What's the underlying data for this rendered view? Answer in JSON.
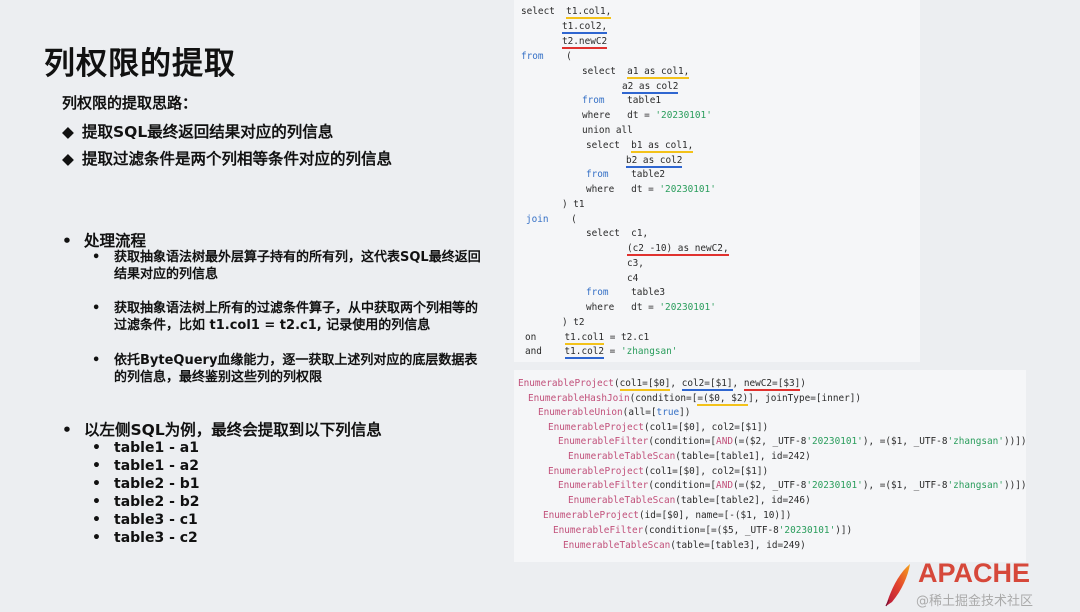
{
  "left": {
    "title": "列权限的提取",
    "subtitle": "列权限的提取思路：",
    "ideas": [
      "提取SQL最终返回结果对应的列信息",
      "提取过滤条件是两个列相等条件对应的列信息"
    ],
    "process_title": "处理流程",
    "steps": [
      "获取抽象语法树最外层算子持有的所有列，这代表SQL最终返回结果对应的列信息",
      "获取抽象语法树上所有的过滤条件算子，从中获取两个列相等的过滤条件，比如 t1.col1 = t2.c1, 记录使用的列信息",
      "依托ByteQuery血缘能力，逐一获取上述列对应的底层数据表的列信息，最终鉴别这些列的列权限"
    ],
    "example_title": "以左侧SQL为例，最终会提取到以下列信息",
    "relations": [
      "table1 - a1",
      "table1 - a2",
      "table2 - b1",
      "table2 - b2",
      "table3 - c1",
      "table3 - c2"
    ]
  },
  "sql": {
    "select": "select",
    "t1col1": "t1.col1,",
    "t1col2": "t1.col2,",
    "t2newc2": "t2.newC2",
    "from": "from",
    "lparen": "(",
    "a1": "a1 as col1,",
    "a2": "a2 as col2",
    "table1": "table1",
    "where": "where",
    "dteq": "dt = ",
    "date": "'20230101'",
    "unionall": "union all",
    "b1": "b1 as col1,",
    "b2": "b2 as col2",
    "table2": "table2",
    "t1close": ") t1",
    "join": "join",
    "c1": "c1,",
    "c2expr": "(c2 -10) as newC2,",
    "c3": "c3,",
    "c4": "c4",
    "table3": "table3",
    "t2close": ") t2",
    "on": "on",
    "oncol": "t1.col1",
    "oneq": " = t2.c1",
    "and": "and",
    "andcol": "t1.col2",
    "andeq": " = ",
    "zhangsan": "'zhangsan'"
  },
  "plan": [
    "EnumerableProject(col1=[$0], col2=[$1], newC2=[$3])",
    "EnumerableHashJoin(condition=[=($0, $2)], joinType=[inner])",
    "EnumerableUnion(all=[true])",
    "EnumerableProject(col1=[$0], col2=[$1])",
    "EnumerableFilter(condition=[AND(=($2, _UTF-8'20230101'), =($1, _UTF-8'zhangsan'))])",
    "EnumerableTableScan(table=[table1], id=242)",
    "EnumerableProject(col1=[$0], col2=[$1])",
    "EnumerableFilter(condition=[AND(=($2, _UTF-8'20230101'), =($1, _UTF-8'zhangsan'))])",
    "EnumerableTableScan(table=[table2], id=246)",
    "EnumerableProject(id=[$0], name=[-($1, 10)])",
    "EnumerableFilter(condition=[=($5, _UTF-8'20230101')])",
    "EnumerableTableScan(table=[table3], id=249)"
  ],
  "logo": {
    "text": "APACHE",
    "color": "#d6483a"
  },
  "watermark": "@稀土掘金技术社区",
  "colors": {
    "yellow": "#f3c21a",
    "blue": "#2f66d0",
    "red": "#e0322f"
  }
}
